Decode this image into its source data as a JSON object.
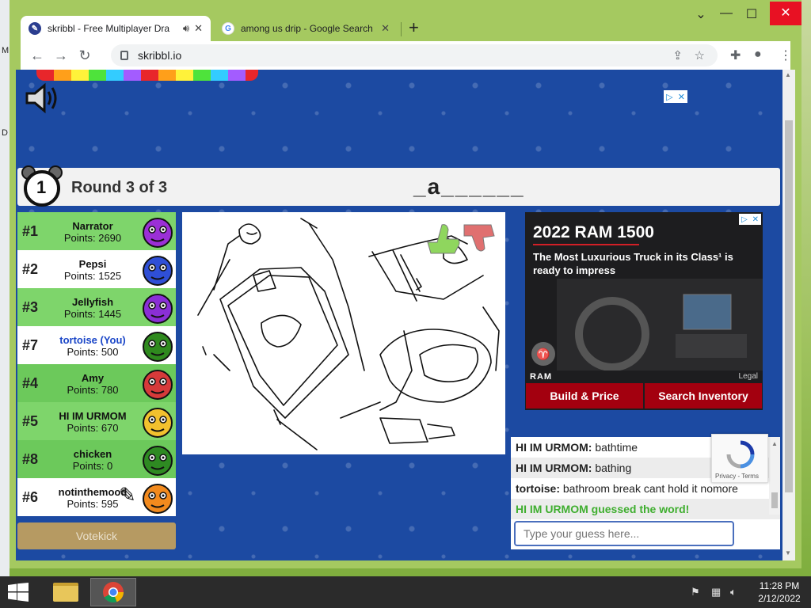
{
  "browser": {
    "tabs": [
      {
        "title": "skribbl - Free Multiplayer Dra",
        "favicon": "skribbl-favicon",
        "active": true
      },
      {
        "title": "among us drip - Google Search",
        "favicon": "google-g-icon",
        "active": false
      }
    ],
    "new_tab": "+",
    "tab_list": "⌄",
    "minimize": "—",
    "maximize": "☐",
    "close": "✕",
    "url": "skribbl.io"
  },
  "desktop_left": {
    "letters": [
      "M",
      "D"
    ]
  },
  "game": {
    "timer": "1",
    "round_text": "Round 3 of 3",
    "word_hint": "_a______",
    "players": [
      {
        "rank": "#1",
        "name": "Narrator",
        "points": "Points: 2690",
        "color": "#9b2fd6",
        "bg": "g1"
      },
      {
        "rank": "#2",
        "name": "Pepsi",
        "points": "Points: 1525",
        "color": "#2f4fd6",
        "bg": "g2"
      },
      {
        "rank": "#3",
        "name": "Jellyfish",
        "points": "Points: 1445",
        "color": "#8a2fd6",
        "bg": "g1"
      },
      {
        "rank": "#7",
        "name": "tortoise (You)",
        "points": "Points: 500",
        "color": "#2f8a1e",
        "bg": "g2",
        "you": true
      },
      {
        "rank": "#4",
        "name": "Amy",
        "points": "Points: 780",
        "color": "#d63a3a",
        "bg": "g3"
      },
      {
        "rank": "#5",
        "name": "HI IM URMOM",
        "points": "Points: 670",
        "color": "#f2c12e",
        "bg": "g1"
      },
      {
        "rank": "#8",
        "name": "chicken",
        "points": "Points: 0",
        "color": "#2e8a22",
        "bg": "g3"
      },
      {
        "rank": "#6",
        "name": "notinthemood",
        "points": "Points: 595",
        "color": "#f28a1e",
        "bg": "g2",
        "drawing": true
      }
    ],
    "votekick": "Votekick"
  },
  "ad": {
    "headline": "2022 RAM 1500",
    "subline": "The Most Luxurious Truck in its Class¹ is ready to impress",
    "brand": "RAM",
    "legal": "Legal",
    "btn_build": "Build & Price",
    "btn_search": "Search Inventory"
  },
  "chat": {
    "messages": [
      {
        "user": "HI IM URMOM:",
        "text": " bathtime"
      },
      {
        "user": "HI IM URMOM:",
        "text": " bathing"
      },
      {
        "user": "tortoise:",
        "text": " bathroom break cant hold it nomore"
      }
    ],
    "guessed": "HI IM URMOM guessed the word!",
    "input_placeholder": "Type your guess here...",
    "recaptcha_links": "Privacy - Terms"
  },
  "taskbar": {
    "time": "11:28 PM",
    "date": "2/12/2022"
  }
}
